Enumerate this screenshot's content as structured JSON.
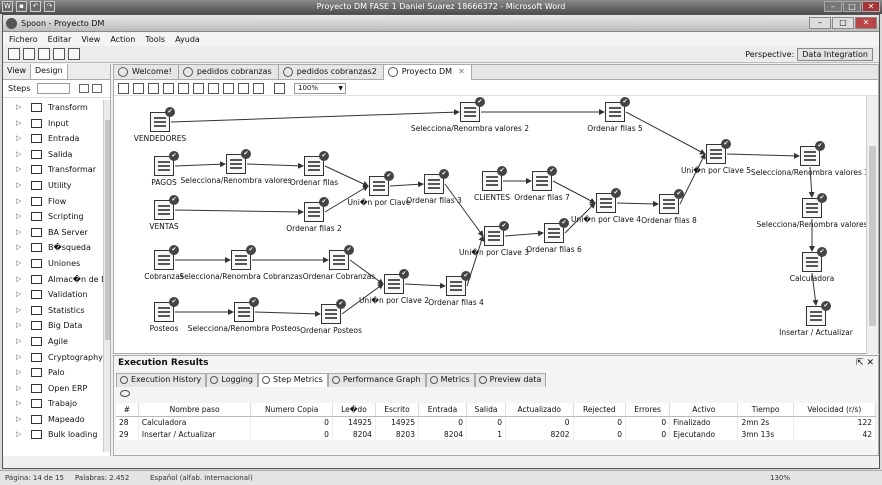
{
  "word": {
    "title": "Proyecto DM FASE 1 Daniel Suarez 18666372 - Microsoft Word",
    "status": {
      "page": "Página: 14 de 15",
      "words": "Palabras: 2.452",
      "language": "Español (alfab. internacional)",
      "zoom": "130%"
    }
  },
  "spoon": {
    "title": "Spoon - Proyecto DM",
    "menu": [
      "Fichero",
      "Editar",
      "View",
      "Action",
      "Tools",
      "Ayuda"
    ],
    "perspective_label": "Perspective:",
    "perspective_value": "Data Integration"
  },
  "left_panel": {
    "tabs": [
      "View",
      "Design"
    ],
    "steps_label": "Steps",
    "items": [
      "Transform",
      "Input",
      "Entrada",
      "Salida",
      "Transformar",
      "Utility",
      "Flow",
      "Scripting",
      "BA Server",
      "B�squeda",
      "Uniones",
      "Almac�n de D",
      "Validation",
      "Statistics",
      "Big Data",
      "Agile",
      "Cryptography",
      "Palo",
      "Open ERP",
      "Trabajo",
      "Mapeado",
      "Bulk loading"
    ]
  },
  "editor": {
    "tabs": [
      "Welcome!",
      "pedidos cobranzas",
      "pedidos cobranzas2",
      "Proyecto DM"
    ],
    "zoom": "100%",
    "nodes": [
      {
        "label": "VENDEDORES"
      },
      {
        "label": "Selecciona/Renombra valores 2"
      },
      {
        "label": "Ordenar filas 5"
      },
      {
        "label": "Uni�n por Clave 5"
      },
      {
        "label": "Selecciona/Renombra valores 3"
      },
      {
        "label": "Selecciona/Renombra valores"
      },
      {
        "label": "Calculadora"
      },
      {
        "label": "Insertar / Actualizar"
      },
      {
        "label": "PAGOS"
      },
      {
        "label": "Selecciona/Renombra valores"
      },
      {
        "label": "Ordenar filas"
      },
      {
        "label": "Uni�n por Clave"
      },
      {
        "label": "Ordenar filas 3"
      },
      {
        "label": "CLIENTES"
      },
      {
        "label": "Ordenar filas 7"
      },
      {
        "label": "Uni�n por Clave 4"
      },
      {
        "label": "Ordenar filas 8"
      },
      {
        "label": "VENTAS"
      },
      {
        "label": "Ordenar filas 2"
      },
      {
        "label": "Uni�n por Clave 3"
      },
      {
        "label": "Ordenar filas 6"
      },
      {
        "label": "Cobranzas"
      },
      {
        "label": "Selecciona/Renombra Cobranzas"
      },
      {
        "label": "Ordenar Cobranzas"
      },
      {
        "label": "Uni�n por Clave 2"
      },
      {
        "label": "Ordenar filas 4"
      },
      {
        "label": "Posteos"
      },
      {
        "label": "Selecciona/Renombra Posteos"
      },
      {
        "label": "Ordenar Posteos"
      }
    ]
  },
  "exec": {
    "title": "Execution Results",
    "tabs": [
      "Execution History",
      "Logging",
      "Step Metrics",
      "Performance Graph",
      "Metrics",
      "Preview data"
    ],
    "columns": [
      "#",
      "Nombre paso",
      "Numero Copia",
      "Le�do",
      "Escrito",
      "Entrada",
      "Salida",
      "Actualizado",
      "Rejected",
      "Errores",
      "Activo",
      "Tiempo",
      "Velocidad (r/s)"
    ],
    "rows": [
      [
        "28",
        "Calculadora",
        "0",
        "14925",
        "14925",
        "0",
        "0",
        "0",
        "0",
        "0",
        "Finalizado",
        "2mn 2s",
        "122"
      ],
      [
        "29",
        "Insertar / Actualizar",
        "0",
        "8204",
        "8203",
        "8204",
        "1",
        "8202",
        "0",
        "0",
        "Ejecutando",
        "3mn 13s",
        "42"
      ]
    ]
  }
}
